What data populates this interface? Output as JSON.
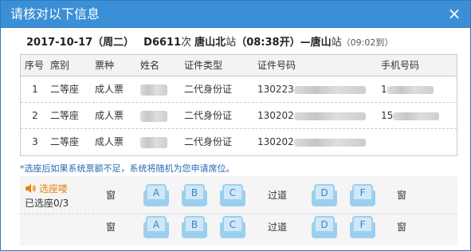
{
  "dialog": {
    "title": "请核对以下信息",
    "close_glyph": "×"
  },
  "trip": {
    "date": "2017-10-17",
    "weekday": "（周二）",
    "train_no": "D6611",
    "train_suffix": "次",
    "from_station": "唐山北",
    "station_suffix": "站",
    "depart_time": "（08:38开）",
    "arrow": "—",
    "to_station": "唐山",
    "arrive_time": "（09:02到）"
  },
  "table": {
    "headers": [
      "序号",
      "席别",
      "票种",
      "姓名",
      "证件类型",
      "证件号码",
      "手机号码"
    ],
    "rows": [
      {
        "no": "1",
        "seat_class": "二等座",
        "ticket_type": "成人票",
        "id_type": "二代身份证",
        "id_prefix": "130223",
        "phone_prefix": "1"
      },
      {
        "no": "2",
        "seat_class": "二等座",
        "ticket_type": "成人票",
        "id_type": "二代身份证",
        "id_prefix": "130202",
        "phone_prefix": "15"
      },
      {
        "no": "3",
        "seat_class": "二等座",
        "ticket_type": "成人票",
        "id_type": "二代身份证",
        "id_prefix": "130202",
        "phone_prefix": ""
      }
    ]
  },
  "note": "*选座后如果系统票额不足，系统将随机为您申请席位。",
  "seat_select": {
    "label": "选座喽",
    "chosen": "已选座0/3",
    "window_label": "窗",
    "aisle_label": "过道",
    "seats": [
      "A",
      "B",
      "C",
      "D",
      "F"
    ]
  },
  "colors": {
    "titlebar": "#3b8fd6",
    "note": "#2c6ab3",
    "seat_label": "#e8830a",
    "seat_fill": "#cfe8f9",
    "seat_border": "#9ccfee"
  }
}
